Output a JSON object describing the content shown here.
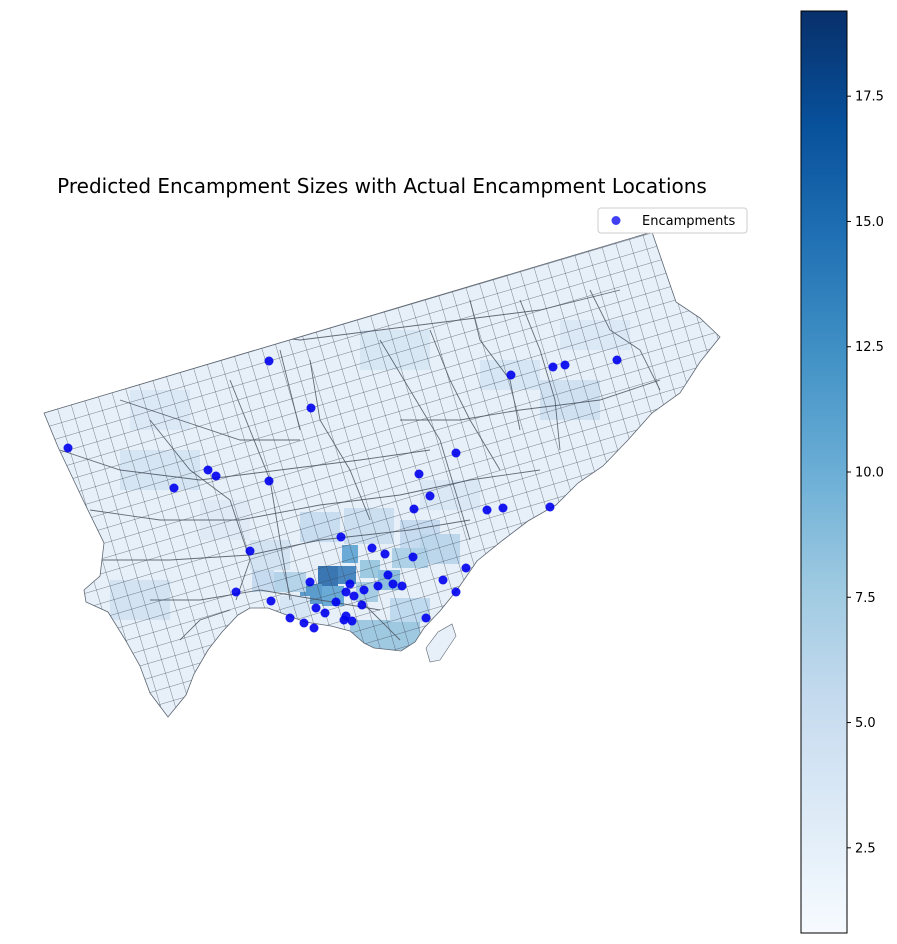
{
  "chart_data": {
    "type": "map",
    "title": "Predicted Encampment Sizes with Actual Encampment Locations",
    "legend": {
      "entries": [
        "Encampments"
      ],
      "placement": "top-right"
    },
    "colorbar": {
      "cmap": "Blues",
      "range": [
        0.8,
        19.2
      ],
      "ticks": [
        2.5,
        5.0,
        7.5,
        10.0,
        12.5,
        15.0,
        17.5
      ],
      "tick_labels": [
        "2.5",
        "5.0",
        "7.5",
        "10.0",
        "12.5",
        "15.0",
        "17.5"
      ]
    },
    "encampment_marker_color": "#0000ee",
    "outline_color": "#6a7480"
  }
}
